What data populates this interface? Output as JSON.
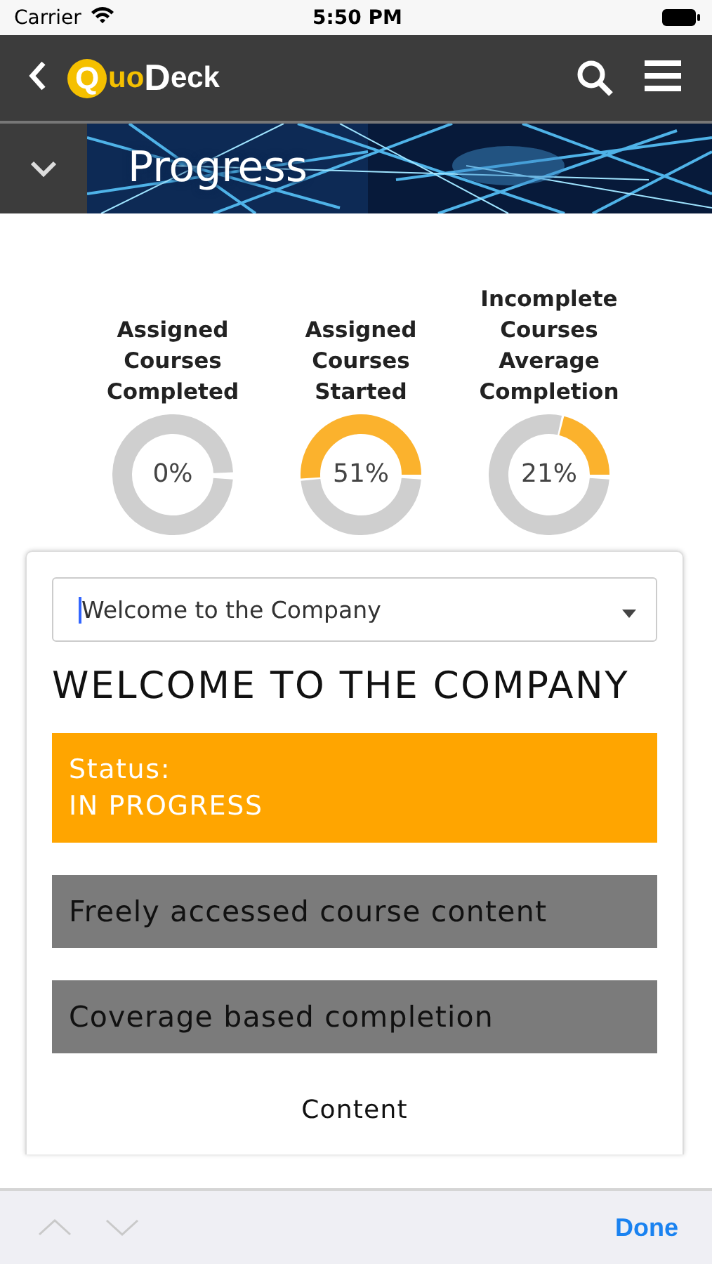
{
  "status_bar": {
    "carrier": "Carrier",
    "time": "5:50 PM"
  },
  "nav_bar": {
    "logo_first": "Q",
    "logo_rest": "uoDeck"
  },
  "banner": {
    "title": "Progress",
    "expanded": true
  },
  "stats": [
    {
      "label": "Assigned Courses Completed",
      "value": "0%"
    },
    {
      "label": "Assigned Courses Started",
      "value": "51%"
    },
    {
      "label": "Incomplete Courses Average Completion",
      "value": "21%"
    }
  ],
  "course_select": {
    "value": "Welcome to the Company"
  },
  "course": {
    "title": "WELCOME TO THE COMPANY",
    "status_label": "Status:",
    "status": "IN PROGRESS",
    "tags": [
      "Freely accessed course content",
      "Coverage based completion"
    ],
    "chart_label": "Content"
  },
  "keyboard_toolbar": {
    "done": "Done"
  }
}
